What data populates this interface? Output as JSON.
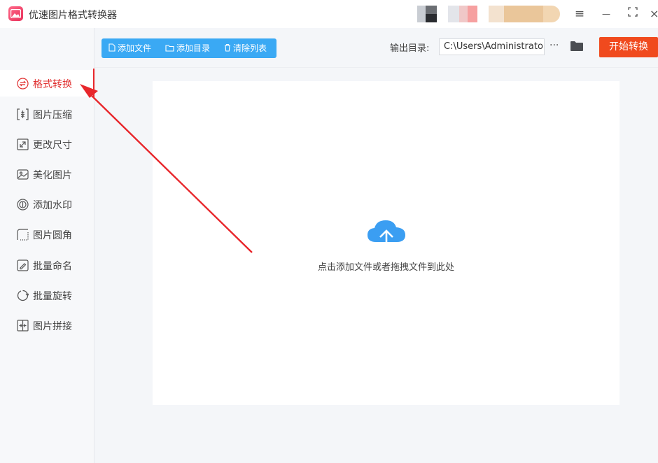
{
  "app": {
    "title": "优速图片格式转换器"
  },
  "colors": {
    "accent_blue": "#3aa9f4",
    "start_orange": "#f04a1e",
    "active_red": "#e02e2e",
    "annotation_red": "#e8262b"
  },
  "window_controls": {
    "menu": "≡",
    "minimize": "—",
    "maximize": "⛶",
    "close": "×"
  },
  "sidebar": {
    "items": [
      {
        "label": "格式转换",
        "icon": "convert-icon",
        "active": true
      },
      {
        "label": "图片压缩",
        "icon": "compress-icon",
        "active": false
      },
      {
        "label": "更改尺寸",
        "icon": "resize-icon",
        "active": false
      },
      {
        "label": "美化图片",
        "icon": "beautify-icon",
        "active": false
      },
      {
        "label": "添加水印",
        "icon": "watermark-icon",
        "active": false
      },
      {
        "label": "图片圆角",
        "icon": "round-corner-icon",
        "active": false
      },
      {
        "label": "批量命名",
        "icon": "rename-icon",
        "active": false
      },
      {
        "label": "批量旋转",
        "icon": "rotate-icon",
        "active": false
      },
      {
        "label": "图片拼接",
        "icon": "stitch-icon",
        "active": false
      }
    ]
  },
  "toolbar": {
    "add_file": "添加文件",
    "add_folder": "添加目录",
    "clear_list": "清除列表"
  },
  "output": {
    "label": "输出目录:",
    "path": "C:\\Users\\Administrator\\",
    "more": "···"
  },
  "start_button": "开始转换",
  "drop_area": {
    "hint": "点击添加文件或者拖拽文件到此处",
    "icon": "cloud-upload-icon"
  }
}
